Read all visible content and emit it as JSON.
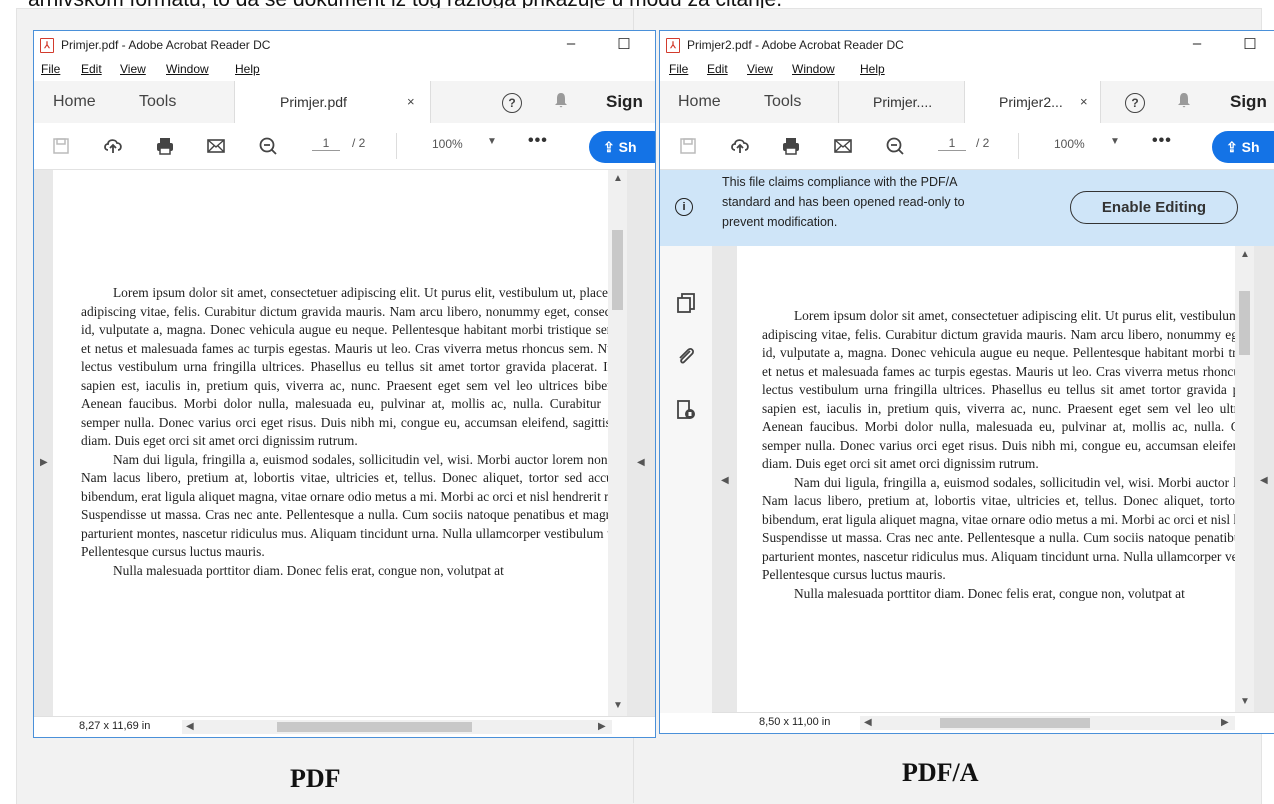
{
  "top_caption": "arhivskom formatu, to da se dokument iz tog razloga prikazuje u modu za čitanje.",
  "figure": {
    "label_left": "PDF",
    "label_right": "PDF/A"
  },
  "common": {
    "menu": [
      "File",
      "Edit",
      "View",
      "Window",
      "Help"
    ],
    "tabs": {
      "home": "Home",
      "tools": "Tools",
      "sign": "Sign",
      "close_glyph": "×"
    },
    "toolbar": {
      "page_current": "1",
      "page_total": "/ 2",
      "zoom": "100%",
      "more": "•••",
      "share_label": "Sh"
    },
    "window_controls": {
      "minimize": "–",
      "maximize": "☐"
    },
    "icons": [
      "pdf-icon",
      "save-icon",
      "upload-icon",
      "print-icon",
      "email-icon",
      "zoom-out-icon",
      "help-icon",
      "bell-icon",
      "share-icon",
      "copy-pages-icon",
      "attachment-icon",
      "lock-icon",
      "info-icon"
    ],
    "body_text": {
      "para1": "Lorem ipsum dolor sit amet, consectetuer adipiscing elit. Ut purus elit, vestibulum ut, placerat ac, adipiscing vitae, felis. Curabitur dictum gravida mauris. Nam arcu libero, nonummy eget, consectetuer id, vulputate a, magna. Donec vehicula augue eu neque. Pellentesque habitant morbi tristique senectus et netus et malesuada fames ac turpis egestas. Mauris ut leo. Cras viverra metus rhoncus sem. Nulla et lectus vestibulum urna fringilla ultrices. Phasellus eu tellus sit amet tortor gravida placerat. Integer sapien est, iaculis in, pretium quis, viverra ac, nunc. Praesent eget sem vel leo ultrices bibendum. Aenean faucibus. Morbi dolor nulla, malesuada eu, pulvinar at, mollis ac, nulla. Curabitur auctor semper nulla. Donec varius orci eget risus. Duis nibh mi, congue eu, accumsan eleifend, sagittis quis, diam. Duis eget orci sit amet orci dignissim rutrum.",
      "para2": "Nam dui ligula, fringilla a, euismod sodales, sollicitudin vel, wisi. Morbi auctor lorem non justo. Nam lacus libero, pretium at, lobortis vitae, ultricies et, tellus. Donec aliquet, tortor sed accumsan bibendum, erat ligula aliquet magna, vitae ornare odio metus a mi. Morbi ac orci et nisl hendrerit mollis. Suspendisse ut massa. Cras nec ante. Pellentesque a nulla. Cum sociis natoque penatibus et magnis dis parturient montes, nascetur ridiculus mus. Aliquam tincidunt urna. Nulla ullamcorper vestibulum turpis. Pellentesque cursus luctus mauris.",
      "para3": "Nulla malesuada porttitor diam. Donec felis erat, congue non, volutpat at"
    }
  },
  "left": {
    "title": "Primjer.pdf - Adobe Acrobat Reader DC",
    "doc_tab": "Primjer.pdf",
    "page_size": "8,27 x 11,69 in"
  },
  "right": {
    "title": "Primjer2.pdf - Adobe Acrobat Reader DC",
    "tab_inactive": "Primjer....",
    "tab_active": "Primjer2...",
    "page_size": "8,50 x 11,00 in",
    "banner": {
      "line1": "This file claims compliance with the PDF/A",
      "line2": "standard and has been opened read-only to",
      "line3": "prevent modification.",
      "button": "Enable Editing"
    }
  }
}
